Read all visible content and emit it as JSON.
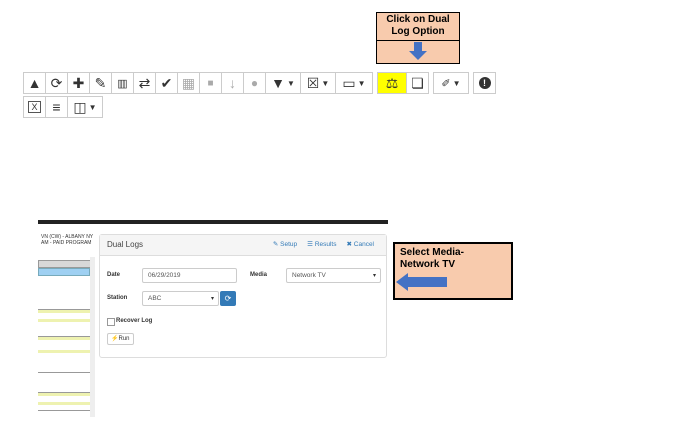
{
  "callout_dual_log": {
    "text": "Click on Dual Log  Option"
  },
  "callout_media": {
    "text": "Select Media- Network TV"
  },
  "toolbar": {
    "row1": [
      {
        "icon": "tree-icon",
        "glyph": "▲",
        "interactable": true
      },
      {
        "icon": "refresh-icon",
        "glyph": "⟳",
        "interactable": true
      },
      {
        "icon": "plus-icon",
        "glyph": "✚",
        "interactable": true
      },
      {
        "icon": "edit-icon",
        "glyph": "✎",
        "interactable": true
      },
      {
        "icon": "trash-icon",
        "glyph": "🗑",
        "interactable": true
      },
      {
        "icon": "swap-icon",
        "glyph": "⇄",
        "interactable": true
      },
      {
        "icon": "check-icon",
        "glyph": "✔",
        "interactable": true
      },
      {
        "icon": "calendar-icon",
        "glyph": "▦",
        "interactable": true
      },
      {
        "icon": "video-icon",
        "glyph": "■",
        "interactable": true
      },
      {
        "icon": "sort-icon",
        "glyph": "↓",
        "interactable": true
      },
      {
        "icon": "globe-icon",
        "glyph": "●",
        "interactable": true
      }
    ],
    "dual_log_glyph": "⚖",
    "copy_glyph": "❏",
    "wrench_glyph": "🔧",
    "alert_glyph": "!",
    "filter_glyph": "▼",
    "close_box_glyph": "☒",
    "monitor_glyph": "▭",
    "export_glyph": "X",
    "database_glyph": "≡",
    "columns_glyph": "◫"
  },
  "left_panel": {
    "line1": "VN (CW) - ALBANY NY",
    "line2": "AM - PAID PROGRAM"
  },
  "dual_logs": {
    "title": "Dual Logs",
    "setup": "Setup",
    "results": "Results",
    "cancel": "Cancel",
    "date_label": "Date",
    "date_value": "06/29/2019",
    "media_label": "Media",
    "media_value": "Network TV",
    "station_label": "Station",
    "station_value": "ABC",
    "recover_label": "Recover Log",
    "run_label": "Run"
  },
  "colors": {
    "callout": "#f8cbad",
    "arrow": "#4472c4",
    "highlight": "#ffff00",
    "link": "#337ab7"
  }
}
